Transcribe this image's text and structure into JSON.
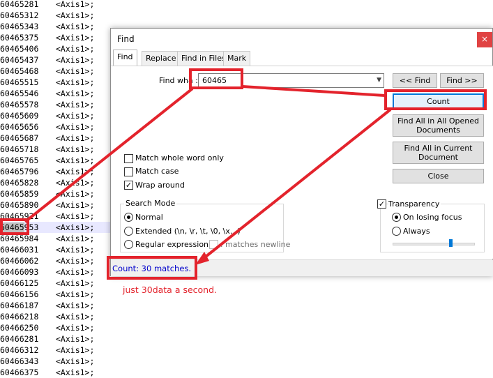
{
  "editor": {
    "lines": [
      {
        "num": "60465281",
        "code": "<Axis1>;"
      },
      {
        "num": "60465312",
        "code": "<Axis1>;"
      },
      {
        "num": "60465343",
        "code": "<Axis1>;"
      },
      {
        "num": "60465375",
        "code": "<Axis1>;"
      },
      {
        "num": "60465406",
        "code": "<Axis1>;"
      },
      {
        "num": "60465437",
        "code": "<Axis1>;"
      },
      {
        "num": "60465468",
        "code": "<Axis1>;"
      },
      {
        "num": "60465515",
        "code": "<Axis1>;"
      },
      {
        "num": "60465546",
        "code": "<Axis1>;"
      },
      {
        "num": "60465578",
        "code": "<Axis1>;"
      },
      {
        "num": "60465609",
        "code": "<Axis1>;"
      },
      {
        "num": "60465656",
        "code": "<Axis1>;"
      },
      {
        "num": "60465687",
        "code": "<Axis1>;"
      },
      {
        "num": "60465718",
        "code": "<Axis1>;"
      },
      {
        "num": "60465765",
        "code": "<Axis1>;"
      },
      {
        "num": "60465796",
        "code": "<Axis1>;"
      },
      {
        "num": "60465828",
        "code": "<Axis1>;"
      },
      {
        "num": "60465859",
        "code": "<Axis1>;"
      },
      {
        "num": "60465890",
        "code": "<Axis1>;"
      },
      {
        "num": "60465921",
        "code": "<Axis1>;"
      },
      {
        "num": "60465953",
        "code": "<Axis1>;",
        "highlight": "60465",
        "rest": "953"
      },
      {
        "num": "60465984",
        "code": "<Axis1>;"
      },
      {
        "num": "60466031",
        "code": "<Axis1>;"
      },
      {
        "num": "60466062",
        "code": "<Axis1>;"
      },
      {
        "num": "60466093",
        "code": "<Axis1>;"
      },
      {
        "num": "60466125",
        "code": "<Axis1>;"
      },
      {
        "num": "60466156",
        "code": "<Axis1>;"
      },
      {
        "num": "60466187",
        "code": "<Axis1>;"
      },
      {
        "num": "60466218",
        "code": "<Axis1>;"
      },
      {
        "num": "60466250",
        "code": "<Axis1>;"
      },
      {
        "num": "60466281",
        "code": "<Axis1>;"
      },
      {
        "num": "60466312",
        "code": "<Axis1>;"
      },
      {
        "num": "60466343",
        "code": "<Axis1>;"
      },
      {
        "num": "60466375",
        "code": "<Axis1>;"
      }
    ],
    "current_line_index": 20
  },
  "dialog": {
    "title": "Find",
    "close": "×",
    "tabs": [
      "Find",
      "Replace",
      "Find in Files",
      "Mark"
    ],
    "active_tab": 0,
    "find_what_label": "Find wha :",
    "find_what_value": "60465",
    "buttons": {
      "find_prev": "<< Find",
      "find_next": "Find >>",
      "count": "Count",
      "find_all_opened_1": "Find All in All Opened",
      "find_all_opened_2": "Documents",
      "find_all_current_1": "Find All in Current",
      "find_all_current_2": "Document",
      "close": "Close"
    },
    "options": {
      "match_whole_word": {
        "label": "Match whole word only",
        "checked": false
      },
      "match_case": {
        "label": "Match case",
        "checked": false
      },
      "wrap_around": {
        "label": "Wrap around",
        "checked": true
      }
    },
    "search_mode": {
      "title": "Search Mode",
      "normal": "Normal",
      "extended": "Extended (\\n, \\r, \\t, \\0, \\x...)",
      "regex": "Regular expression",
      "matches_newline": ". matches newline",
      "selected": "normal"
    },
    "transparency": {
      "label": "Transparency",
      "checked": true,
      "on_losing_focus": "On losing focus",
      "always": "Always",
      "selected": "on_losing_focus",
      "level": 0.72
    },
    "status": "Count: 30 matches."
  },
  "annotation": {
    "note": "just 30data a second.",
    "color": "#e3232c"
  }
}
